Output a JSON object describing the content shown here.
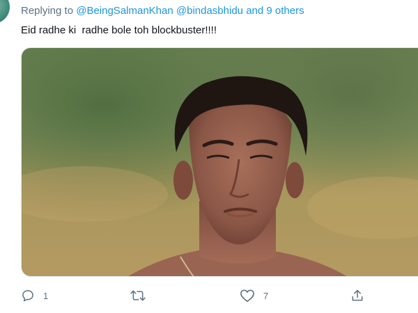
{
  "tweet": {
    "author_cut_text": "",
    "replying_prefix": "Replying to",
    "mentions": [
      "@BeingSalmanKhan",
      "@bindasbhidu"
    ],
    "others_text": "and 9 others",
    "text": "Eid radhe ki  radhe bole toh blockbuster!!!!"
  },
  "media": {
    "description_icon": "photo-of-man"
  },
  "actions": {
    "reply_count": "1",
    "retweet_count": "",
    "like_count": "7",
    "share_count": ""
  },
  "colors": {
    "link": "#1b95e0",
    "secondary": "#5b7083",
    "text": "#0f1419"
  }
}
